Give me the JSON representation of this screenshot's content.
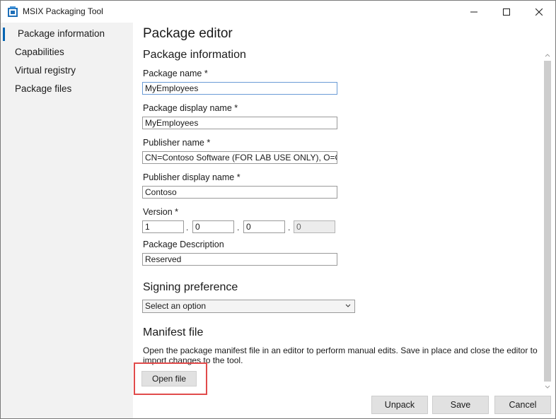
{
  "window": {
    "title": "MSIX Packaging Tool"
  },
  "sidebar": {
    "items": [
      {
        "label": "Package information",
        "active": true
      },
      {
        "label": "Capabilities"
      },
      {
        "label": "Virtual registry"
      },
      {
        "label": "Package files"
      }
    ]
  },
  "main": {
    "title": "Package editor",
    "package_info": {
      "heading": "Package information",
      "package_name": {
        "label": "Package name *",
        "value": "MyEmployees"
      },
      "display_name": {
        "label": "Package display name *",
        "value": "MyEmployees"
      },
      "publisher_name": {
        "label": "Publisher name *",
        "value": "CN=Contoso Software (FOR LAB USE ONLY), O=Co"
      },
      "publisher_display_name": {
        "label": "Publisher display name *",
        "value": "Contoso"
      },
      "version": {
        "label": "Version *",
        "parts": [
          "1",
          "0",
          "0",
          "0"
        ],
        "separator": "."
      },
      "description": {
        "label": "Package Description",
        "value": "Reserved"
      }
    },
    "signing": {
      "heading": "Signing preference",
      "select_value": "Select an option"
    },
    "manifest": {
      "heading": "Manifest file",
      "description": "Open the package manifest file in an editor to perform manual edits. Save in place and close the editor to import changes to the tool.",
      "open_button": "Open file"
    }
  },
  "footer": {
    "unpack": "Unpack",
    "save": "Save",
    "cancel": "Cancel"
  },
  "colors": {
    "accent": "#0063b1",
    "highlight": "#e14b4b",
    "sidebar_bg": "#f2f2f2"
  }
}
